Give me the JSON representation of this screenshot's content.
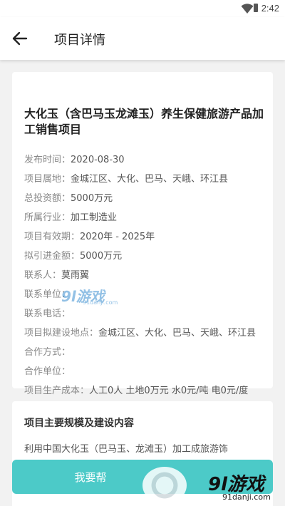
{
  "status_bar": {
    "time": "2:42"
  },
  "app_bar": {
    "title": "项目详情"
  },
  "project": {
    "title": "大化玉（含巴马玉龙滩玉）养生保健旅游产品加工销售项目",
    "fields": [
      {
        "label": "发布时间：",
        "value": "2020-08-30"
      },
      {
        "label": "项目属地：",
        "value": "金城江区、大化、巴马、天峨、环江县"
      },
      {
        "label": "总投资额：",
        "value": "5000万元"
      },
      {
        "label": "所属行业：",
        "value": "加工制造业"
      },
      {
        "label": "项目有效期：",
        "value": "2020年 - 2025年"
      },
      {
        "label": "拟引进金额：",
        "value": "5000万元"
      },
      {
        "label": "联系人：",
        "value": "莫雨翼"
      },
      {
        "label": "联系单位：",
        "value": ""
      },
      {
        "label": "联系电话：",
        "value": ""
      },
      {
        "label": "项目拟建设地点：",
        "value": "金城江区、大化、巴马、天峨、环江县"
      },
      {
        "label": "合作方式：",
        "value": ""
      },
      {
        "label": "合作单位：",
        "value": ""
      },
      {
        "label": "项目生产成本：",
        "value": "人工0人 土地0万元 水0元/吨 电0元/度"
      }
    ]
  },
  "scale_section": {
    "title": "项目主要规模及建设内容",
    "text": "利用中国大化玉（巴马玉、龙滩玉）加工成旅游饰"
  },
  "action": {
    "label": "我要帮"
  },
  "watermark": {
    "center_logo": "9l游戏",
    "center_url": "91danji.com",
    "corner_brand_num": "9l",
    "corner_brand_text": "游戏",
    "corner_url": "91danji.com"
  },
  "colors": {
    "accent": "#4ccac8",
    "background": "#f2f2f2"
  },
  "icons": {
    "back": "arrow-left-icon",
    "wifi": "wifi-icon",
    "battery": "battery-icon"
  }
}
